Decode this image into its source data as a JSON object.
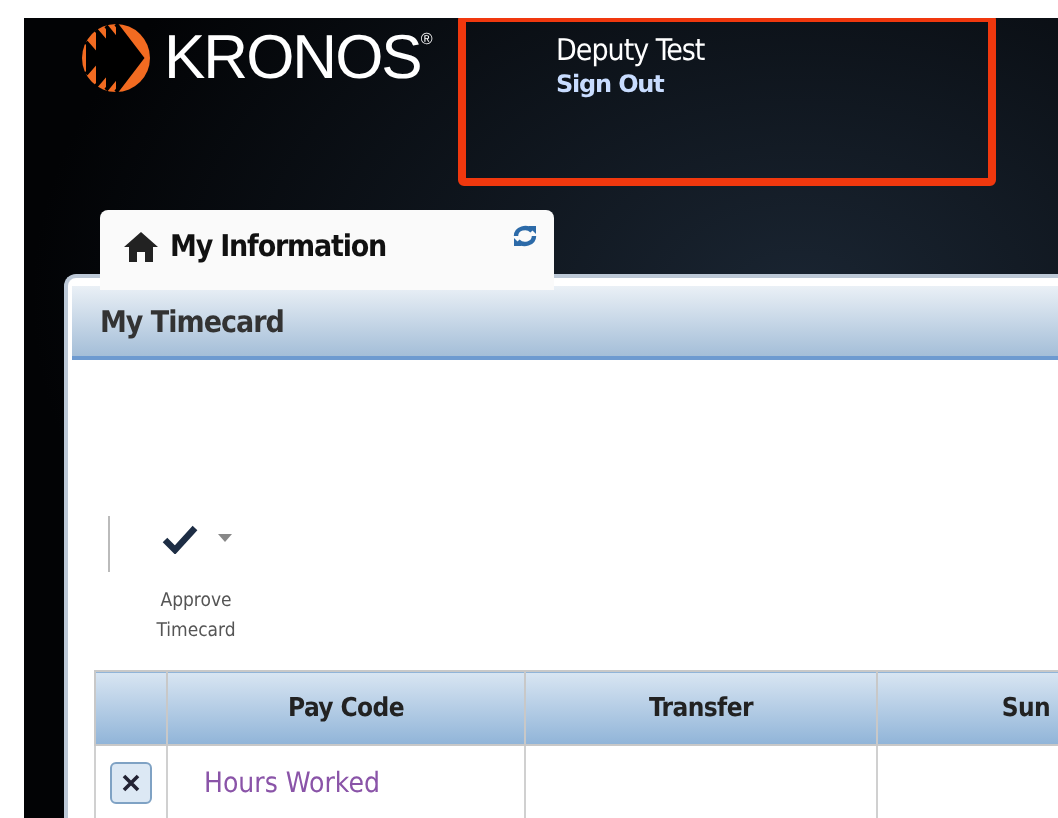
{
  "header": {
    "logo_text": "KRONOS$^{®}$"
  },
  "account": {
    "name": "Deputy Test",
    "sign_out": "Sign Out",
    "highlighted": true
  },
  "tabs": [
    {
      "label": "My Information",
      "selected": true
    }
  ],
  "panel": {
    "title": "My Timecard",
    "toolbar": [
      {
        "label": "Approve Timecard",
        "has_menu": true
      }
    ],
    "table": {
      "columns": [
        {
          "label": "Pay Code"
        },
        {
          "label": "Transfer"
        },
        {
          "label": "Sun"
        }
      ],
      "rows": [
        {
          "pay_code": "Hours Worked"
        }
      ]
    }
  }
}
